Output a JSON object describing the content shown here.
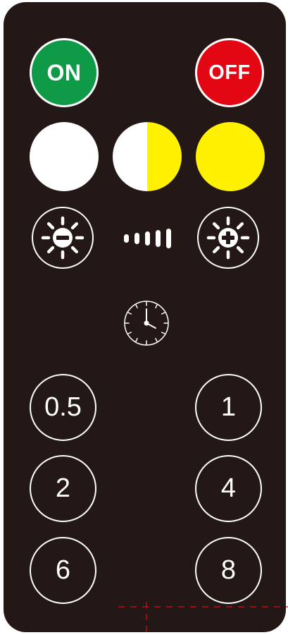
{
  "colors": {
    "body": "#231815",
    "on": "#0f9a48",
    "off": "#e30613",
    "warm": "#fff100",
    "cool": "#ffffff",
    "cut_mark": "#e30613"
  },
  "power": {
    "on_label": "ON",
    "off_label": "OFF"
  },
  "color_modes": [
    {
      "name": "cool-white-icon"
    },
    {
      "name": "mixed-white-yellow-icon"
    },
    {
      "name": "warm-yellow-icon"
    }
  ],
  "brightness": {
    "decrease_icon": "brightness-minus-icon",
    "increase_icon": "brightness-plus-icon",
    "levels": 5
  },
  "timer": {
    "icon": "clock-icon",
    "buttons": [
      "0.5",
      "1",
      "2",
      "4",
      "6",
      "8"
    ]
  }
}
